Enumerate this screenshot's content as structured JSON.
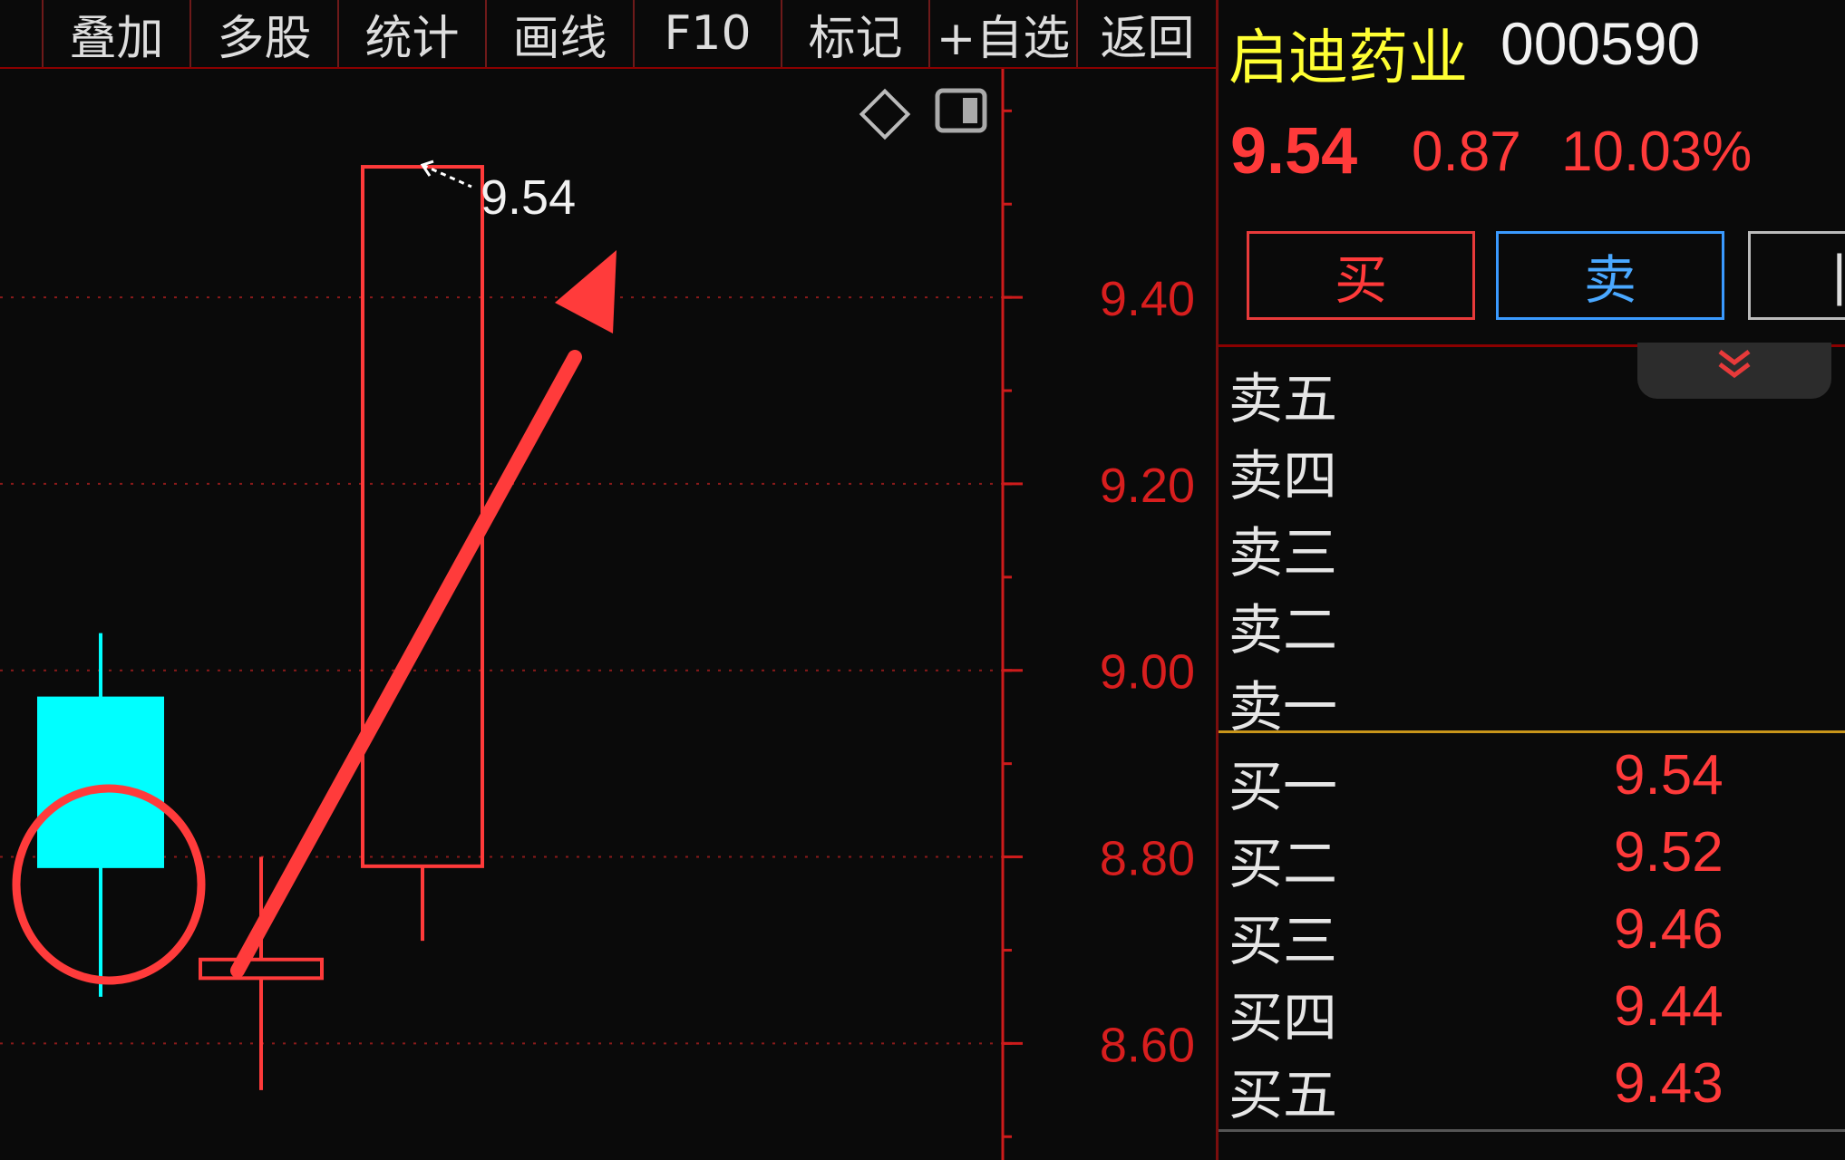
{
  "toolbar": {
    "items": [
      {
        "label": "叠加"
      },
      {
        "label": "多股"
      },
      {
        "label": "统计"
      },
      {
        "label": "画线"
      },
      {
        "label": "F10"
      },
      {
        "label": "标记"
      },
      {
        "label": "+自选"
      },
      {
        "label": "返回"
      }
    ]
  },
  "quote": {
    "name": "启迪药业",
    "code": "000590",
    "price": "9.54",
    "change": "0.87",
    "change_pct": "10.03%"
  },
  "trade": {
    "buy_label": "买",
    "sell_label": "卖"
  },
  "order_book": {
    "asks": [
      {
        "label": "卖五",
        "price": ""
      },
      {
        "label": "卖四",
        "price": ""
      },
      {
        "label": "卖三",
        "price": ""
      },
      {
        "label": "卖二",
        "price": ""
      },
      {
        "label": "卖一",
        "price": ""
      }
    ],
    "bids": [
      {
        "label": "买一",
        "price": "9.54"
      },
      {
        "label": "买二",
        "price": "9.52"
      },
      {
        "label": "买三",
        "price": "9.46"
      },
      {
        "label": "买四",
        "price": "9.44"
      },
      {
        "label": "买五",
        "price": "9.43"
      }
    ]
  },
  "chart_data": {
    "type": "candlestick",
    "y_ticks": [
      "9.40",
      "9.20",
      "9.00",
      "8.80",
      "8.60"
    ],
    "y_tick_values": [
      9.4,
      9.2,
      9.0,
      8.8,
      8.6
    ],
    "ylim": [
      8.475,
      9.645
    ],
    "candles": [
      {
        "open": 8.97,
        "close": 8.79,
        "high": 9.04,
        "low": 8.65,
        "direction": "down"
      },
      {
        "open": 8.67,
        "close": 8.69,
        "high": 8.8,
        "low": 8.55,
        "direction": "up"
      },
      {
        "open": 8.79,
        "close": 9.54,
        "high": 9.54,
        "low": 8.71,
        "direction": "up"
      }
    ],
    "price_label": "9.54",
    "grid": "dotted",
    "annotations": [
      "circle",
      "arrow"
    ]
  },
  "colors": {
    "up": "#ff3a3a",
    "down": "#00ffff",
    "axis": "#cc1b1b",
    "grid": "#8b1a1a",
    "name": "#ffff33",
    "divider": "#c8951a"
  }
}
